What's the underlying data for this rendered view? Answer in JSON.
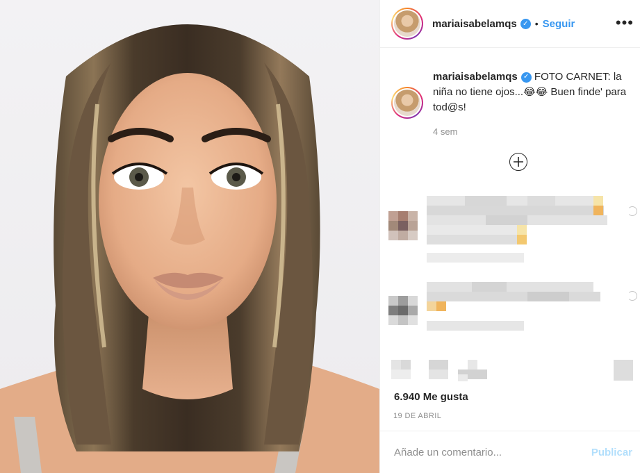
{
  "post": {
    "username": "mariaisabelamqs",
    "verified_icon": "verified-badge-icon",
    "separator": "•",
    "follow_label": "Seguir",
    "more_label": "•••",
    "caption": {
      "username": "mariaisabelamqs",
      "text": "FOTO CARNET: la niña no tiene ojos...😂😂 Buen finde' para tod@s!",
      "time": "4 sem"
    },
    "load_more_icon": "plus-circle-icon",
    "likes": "6.940 Me gusta",
    "date": "19 DE ABRIL",
    "comment_input": {
      "placeholder": "Añade un comentario...",
      "value": ""
    },
    "publish_label": "Publicar"
  },
  "colors": {
    "accent": "#3897f0",
    "publish_disabled": "#b2dffc",
    "muted_text": "#8e8e8e",
    "divider": "#efefef"
  }
}
